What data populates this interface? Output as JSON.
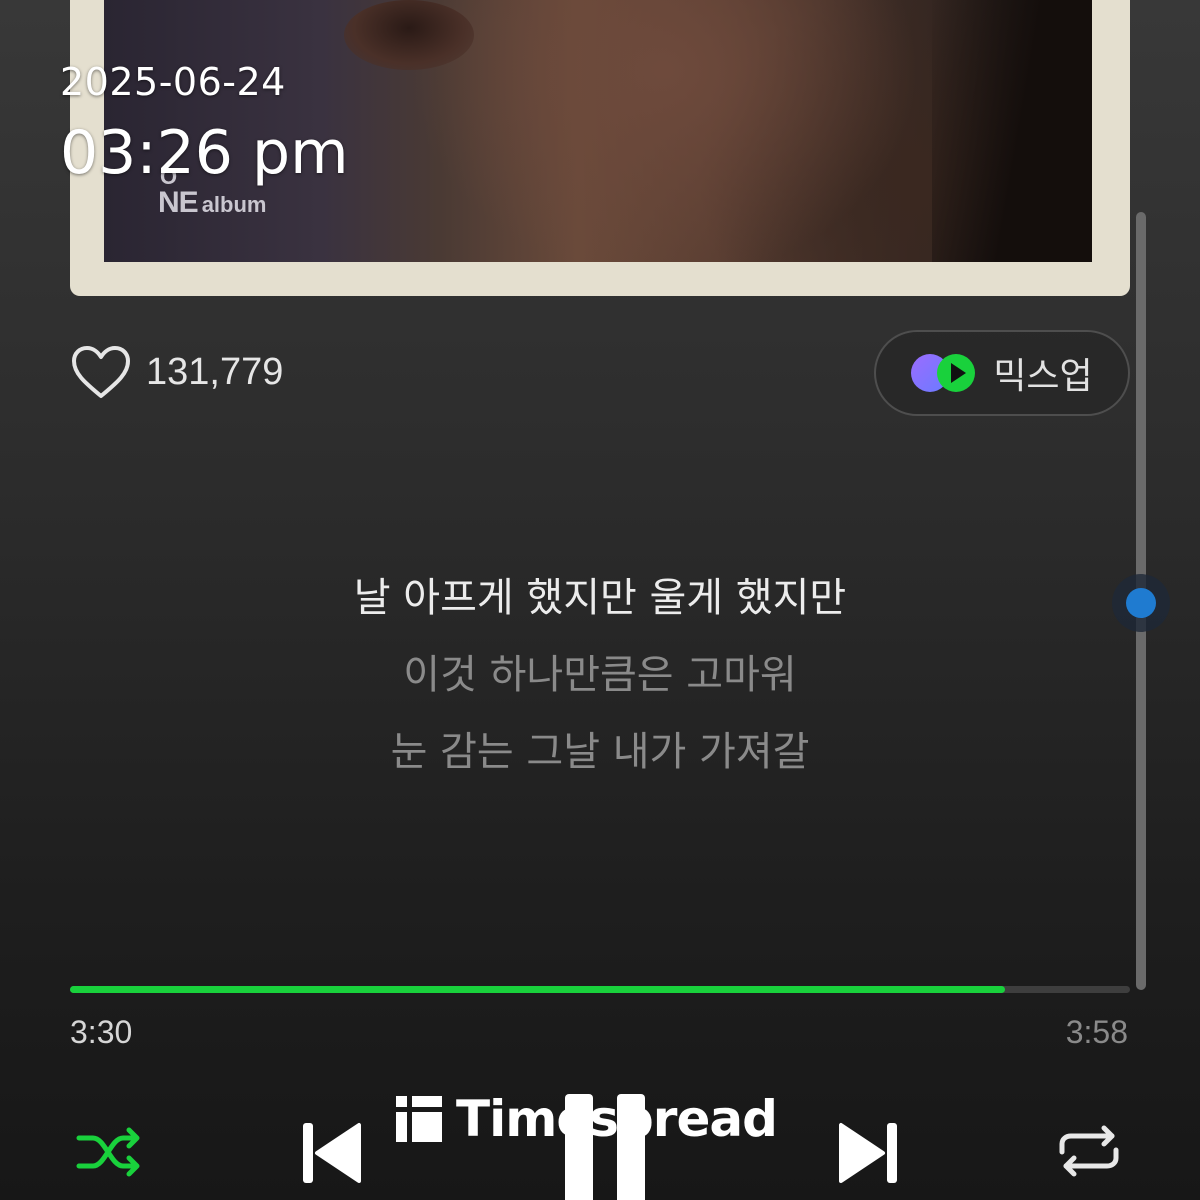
{
  "album": {
    "logo_o": "O",
    "logo_ne": "NE",
    "logo_album": "album"
  },
  "overlay": {
    "date": "2025-06-24",
    "time": "03:26 pm"
  },
  "like": {
    "count": "131,779",
    "icon": "heart-icon"
  },
  "mixup": {
    "label": "믹스업",
    "icon": "mixup-icon"
  },
  "lyrics": [
    {
      "text": "날 아프게 했지만 울게 했지만",
      "active": true
    },
    {
      "text": "이것 하나만큼은 고마워",
      "active": false
    },
    {
      "text": "눈 감는 그날 내가 가져갈",
      "active": false
    }
  ],
  "playback": {
    "elapsed": "3:30",
    "total": "3:58",
    "progress_fraction": 0.882,
    "accent_color": "#19d13c"
  },
  "controls": {
    "shuffle_icon": "shuffle-icon",
    "prev_icon": "skip-previous-icon",
    "play_pause_icon": "pause-icon",
    "next_icon": "skip-next-icon",
    "repeat_icon": "repeat-icon"
  },
  "watermark": {
    "text": "Timespread"
  }
}
